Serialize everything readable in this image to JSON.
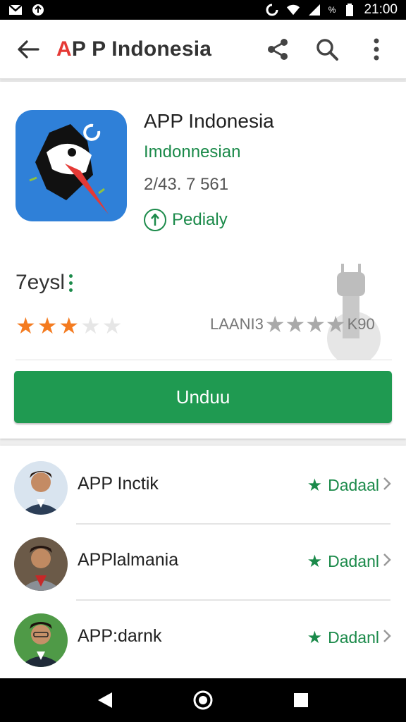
{
  "status_bar": {
    "time": "21:00",
    "left_icons": [
      "gmail-icon",
      "upload-icon"
    ],
    "right_icons": [
      "sync-icon",
      "wifi-icon",
      "signal-icon",
      "battery-icon"
    ],
    "battery_text": "%"
  },
  "app_bar": {
    "logo_a": "A",
    "logo_p": "P",
    "title": "P Indonesia",
    "back_icon": "arrow-back-icon",
    "actions": [
      "share-icon",
      "search-icon",
      "more-vert-icon"
    ]
  },
  "app": {
    "title": "APP Indonesia",
    "developer": "Imdonnesian",
    "meta": "2/43. 7 561",
    "badge": "Pedialy",
    "rating_label": "7eysl",
    "rating_stars": 3,
    "rating_max": 5,
    "rating_right_prefix": "LAANI3",
    "rating_right_stars": 4,
    "rating_right_suffix": "K90",
    "install_label": "Unduu",
    "accent_green": "#1f9a51",
    "star_color": "#f47b20",
    "icon_bg": "#2f80d8"
  },
  "list": {
    "items": [
      {
        "name": "APP Inctik",
        "action": "Dadaal"
      },
      {
        "name": "APPlalmania",
        "action": "Dadanl"
      },
      {
        "name": "APP:darnk",
        "action": "Dadanl"
      }
    ]
  },
  "nav_bar": {
    "buttons": [
      "back-triangle-icon",
      "home-circle-icon",
      "recents-square-icon"
    ]
  }
}
